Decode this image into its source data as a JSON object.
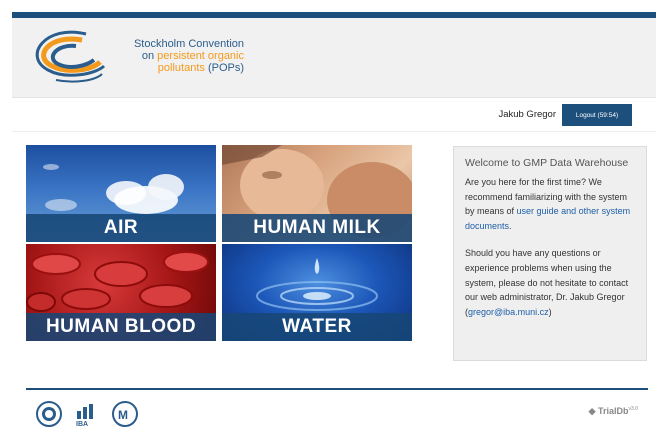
{
  "header": {
    "logo_line1": "Stockholm Convention",
    "logo_line2_prefix": "on",
    "logo_line2_highlight": "persistent organic",
    "logo_line3_highlight": "pollutants",
    "logo_line3_suffix": "(POPs)"
  },
  "userbar": {
    "username": "Jakub Gregor",
    "logout_label": "Logout (59:54)"
  },
  "tiles": [
    {
      "label": "AIR"
    },
    {
      "label": "HUMAN MILK"
    },
    {
      "label": "HUMAN BLOOD"
    },
    {
      "label": "WATER"
    }
  ],
  "welcome": {
    "title": "Welcome to GMP Data Warehouse",
    "p1_text": "Are you here for the first time? We recommend familiarizing with the system by means of",
    "p1_link": "user guide and other system documents",
    "p1_end": ".",
    "p2_text": "Should you have any questions or experience problems when using the system, please do not hesitate to contact our web administrator, Dr. Jakub Gregor (",
    "p2_link": "gregor@iba.muni.cz",
    "p2_end": ")"
  },
  "footer": {
    "trialdb": "TrialDb",
    "trialdb_version": "v3.0"
  },
  "colors": {
    "brand_blue": "#1d4f7c",
    "brand_orange": "#f39a1c"
  }
}
